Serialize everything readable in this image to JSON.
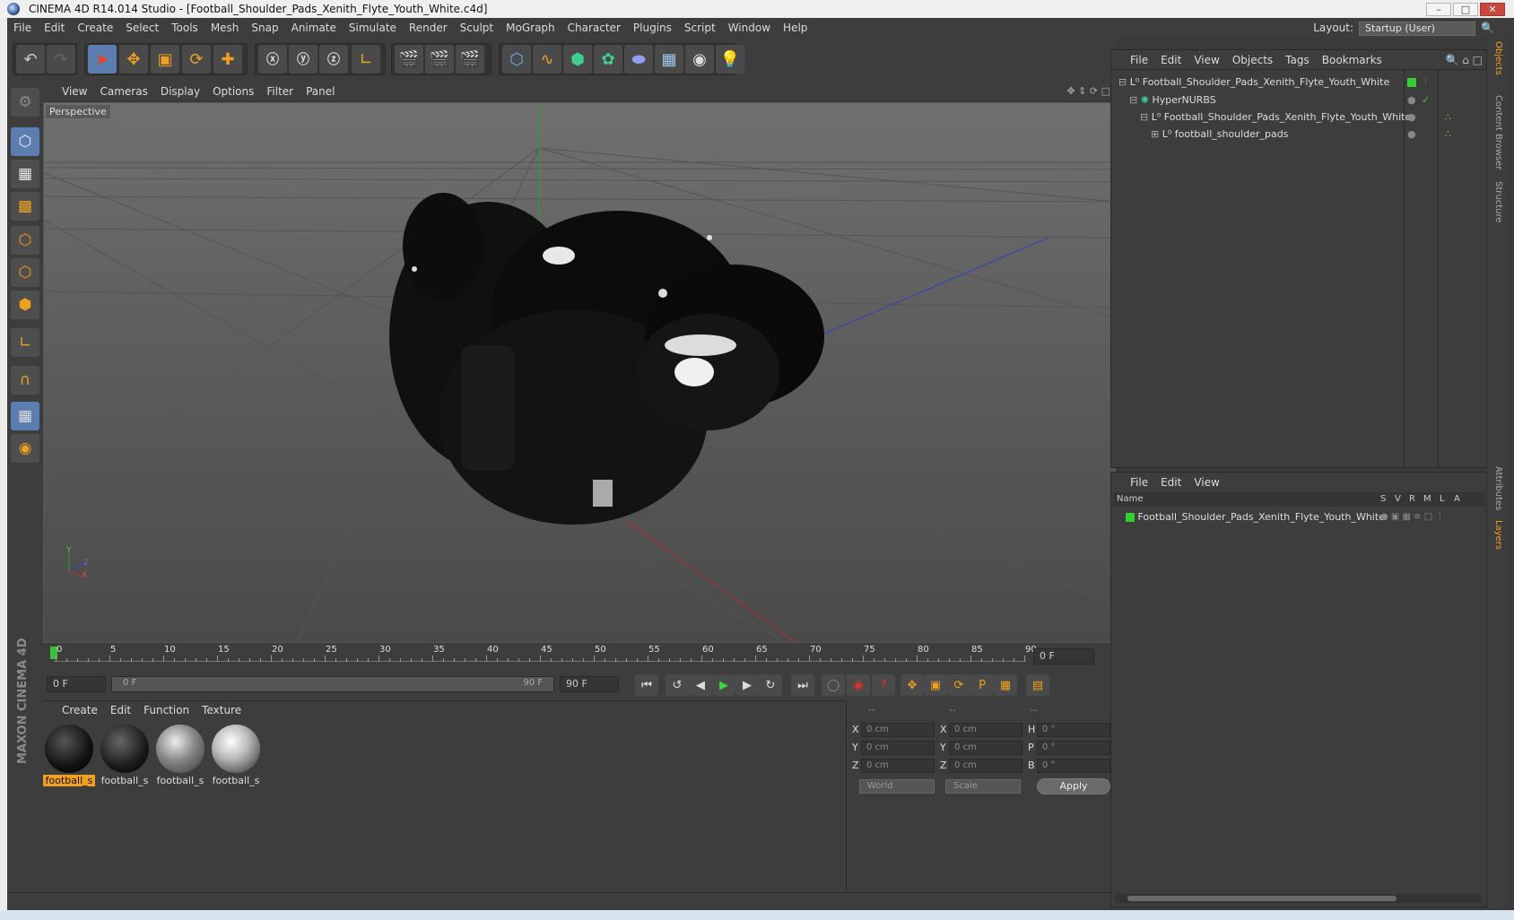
{
  "app": {
    "title": "CINEMA 4D R14.014 Studio - [Football_Shoulder_Pads_Xenith_Flyte_Youth_White.c4d]",
    "accent": "#f0a020"
  },
  "menubar": {
    "items": [
      "File",
      "Edit",
      "Create",
      "Select",
      "Tools",
      "Mesh",
      "Snap",
      "Animate",
      "Simulate",
      "Render",
      "Sculpt",
      "MoGraph",
      "Character",
      "Plugins",
      "Script",
      "Window",
      "Help"
    ],
    "layout_label": "Layout:",
    "layout_value": "Startup (User)"
  },
  "viewport": {
    "menu": [
      "View",
      "Cameras",
      "Display",
      "Options",
      "Filter",
      "Panel"
    ],
    "label": "Perspective",
    "axis_y": "Y",
    "axis_z": "Z",
    "axis_x": "X"
  },
  "timeline": {
    "ticks": [
      "0",
      "5",
      "10",
      "15",
      "20",
      "25",
      "30",
      "35",
      "40",
      "45",
      "50",
      "55",
      "60",
      "65",
      "70",
      "75",
      "80",
      "85",
      "90"
    ],
    "current_frame": "0 F"
  },
  "transport": {
    "start_field": "0 F",
    "range_start": "0 F",
    "range_end": "90 F",
    "end_field": "90 F"
  },
  "materials": {
    "menu": [
      "Create",
      "Edit",
      "Function",
      "Texture"
    ],
    "items": [
      {
        "label": "football_s",
        "selected": true
      },
      {
        "label": "football_s",
        "selected": false
      },
      {
        "label": "football_s",
        "selected": false
      },
      {
        "label": "football_s",
        "selected": false
      }
    ]
  },
  "coordinates": {
    "headers": [
      "--",
      "--",
      "--"
    ],
    "rows": [
      {
        "a": "X",
        "av": "0 cm",
        "b": "X",
        "bv": "0 cm",
        "c": "H",
        "cv": "0 °"
      },
      {
        "a": "Y",
        "av": "0 cm",
        "b": "Y",
        "bv": "0 cm",
        "c": "P",
        "cv": "0 °"
      },
      {
        "a": "Z",
        "av": "0 cm",
        "b": "Z",
        "bv": "0 cm",
        "c": "B",
        "cv": "0 °"
      }
    ],
    "world": "World",
    "scale": "Scale",
    "apply": "Apply"
  },
  "objects": {
    "menu": [
      "File",
      "Edit",
      "View",
      "Objects",
      "Tags",
      "Bookmarks"
    ],
    "tree": [
      {
        "name": "Football_Shoulder_Pads_Xenith_Flyte_Youth_White",
        "depth": 0
      },
      {
        "name": "HyperNURBS",
        "depth": 1
      },
      {
        "name": "Football_Shoulder_Pads_Xenith_Flyte_Youth_White",
        "depth": 2
      },
      {
        "name": "football_shoulder_pads",
        "depth": 3
      }
    ]
  },
  "layers": {
    "menu": [
      "File",
      "Edit",
      "View"
    ],
    "columns": [
      "Name",
      "S",
      "V",
      "R",
      "M",
      "L",
      "A"
    ],
    "rows": [
      {
        "name": "Football_Shoulder_Pads_Xenith_Flyte_Youth_White"
      }
    ]
  },
  "right_tabs": [
    "Objects",
    "Content Browser",
    "Structure",
    "Attributes",
    "Layers"
  ],
  "brand": "MAXON CINEMA 4D"
}
